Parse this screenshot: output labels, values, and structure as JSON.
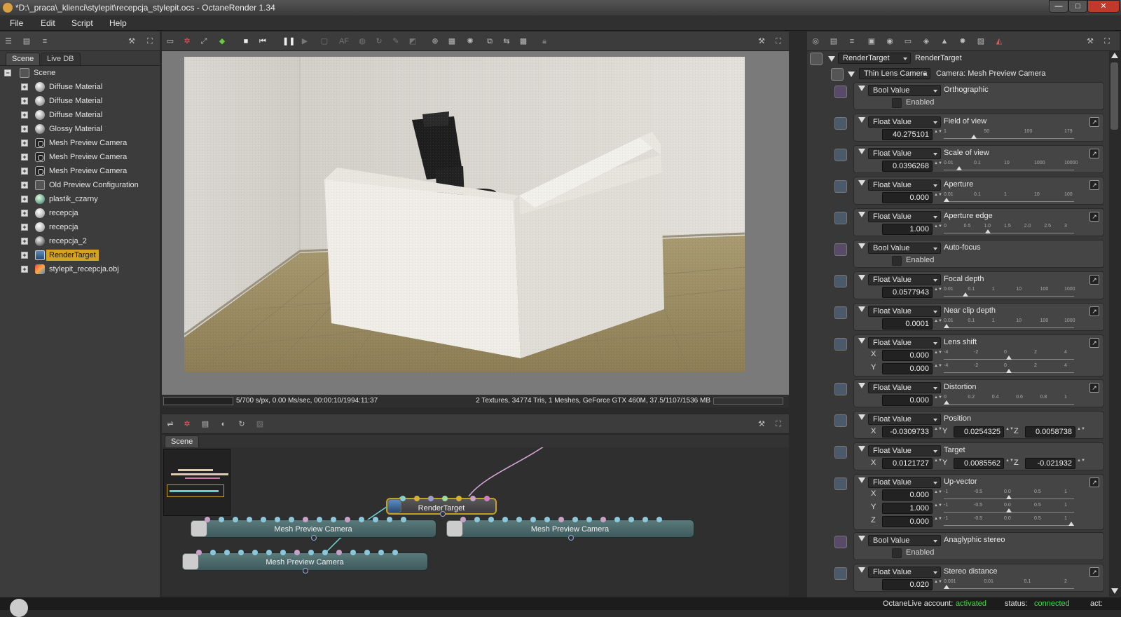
{
  "window": {
    "title": "*D:\\_praca\\_klienci\\stylepit\\recepcja_stylepit.ocs - OctaneRender 1.34",
    "min_label": "—",
    "max_label": "□",
    "close_label": "✕"
  },
  "menu": [
    "File",
    "Edit",
    "Script",
    "Help"
  ],
  "scene_panel": {
    "tabs": [
      "Scene",
      "Live DB"
    ],
    "root": "Scene",
    "items": [
      {
        "label": "Diffuse Material",
        "icon": "diffuse-material-icon"
      },
      {
        "label": "Diffuse Material",
        "icon": "diffuse-material-icon"
      },
      {
        "label": "Diffuse Material",
        "icon": "diffuse-material-icon"
      },
      {
        "label": "Glossy Material",
        "icon": "glossy-material-icon"
      },
      {
        "label": "Mesh Preview Camera",
        "icon": "camera-icon"
      },
      {
        "label": "Mesh Preview Camera",
        "icon": "camera-icon"
      },
      {
        "label": "Mesh Preview Camera",
        "icon": "camera-icon"
      },
      {
        "label": "Old Preview Configuration",
        "icon": "config-icon"
      },
      {
        "label": "plastik_czarny",
        "icon": "material-icon"
      },
      {
        "label": "recepcja",
        "icon": "material-icon"
      },
      {
        "label": "recepcja",
        "icon": "material-icon"
      },
      {
        "label": "recepcja_2",
        "icon": "material-icon"
      },
      {
        "label": "RenderTarget",
        "icon": "render-target-icon",
        "selected": true
      },
      {
        "label": "stylepit_recepcja.obj",
        "icon": "mesh-icon"
      }
    ]
  },
  "render": {
    "status_left": "5/700 s/px, 0.00 Ms/sec, 00:00:10/1994:11:37",
    "status_right": "2 Textures, 34774 Tris, 1 Meshes, GeForce GTX 460M, 37.5/1107/1536 MB"
  },
  "graph": {
    "tab": "Scene",
    "nodes": {
      "render_target": "RenderTarget",
      "camera_1": "Mesh Preview Camera",
      "camera_2": "Mesh Preview Camera",
      "camera_3": "Mesh Preview Camera"
    }
  },
  "props": {
    "header_combo": "RenderTarget",
    "header_label": "RenderTarget",
    "camera_combo": "Thin Lens Camera",
    "camera_label": "Camera:  Mesh Preview Camera",
    "enabled_label": "Enabled",
    "rows": {
      "orthographic": {
        "type": "Bool Value",
        "label": "Orthographic"
      },
      "fov": {
        "type": "Float Value",
        "label": "Field of view",
        "value": "40.275101",
        "ticks": [
          "1",
          "50",
          "100",
          "179"
        ]
      },
      "scale": {
        "type": "Float Value",
        "label": "Scale of view",
        "value": "0.0396268",
        "ticks": [
          "0.01",
          "0.1",
          "10",
          "1000",
          "10000"
        ]
      },
      "aperture": {
        "type": "Float Value",
        "label": "Aperture",
        "value": "0.000",
        "ticks": [
          "0.01",
          "0.1",
          "1",
          "10",
          "100"
        ]
      },
      "aperture_edge": {
        "type": "Float Value",
        "label": "Aperture edge",
        "value": "1.000",
        "ticks": [
          "0",
          "0.5",
          "1.0",
          "1.5",
          "2.0",
          "2.5",
          "3"
        ]
      },
      "autofocus": {
        "type": "Bool Value",
        "label": "Auto-focus"
      },
      "focal_depth": {
        "type": "Float Value",
        "label": "Focal depth",
        "value": "0.0577943",
        "ticks": [
          "0.01",
          "0.1",
          "1",
          "10",
          "100",
          "1000"
        ]
      },
      "near_clip": {
        "type": "Float Value",
        "label": "Near clip depth",
        "value": "0.0001",
        "ticks": [
          "0.01",
          "0.1",
          "1",
          "10",
          "100",
          "1000"
        ]
      },
      "lens_shift": {
        "type": "Float Value",
        "label": "Lens shift",
        "x": "0.000",
        "y": "0.000",
        "ticks": [
          "-4",
          "-2",
          "0",
          "2",
          "4"
        ]
      },
      "distortion": {
        "type": "Float Value",
        "label": "Distortion",
        "value": "0.000",
        "ticks": [
          "0",
          "0.2",
          "0.4",
          "0.6",
          "0.8",
          "1"
        ]
      },
      "position": {
        "type": "Float Value",
        "label": "Position",
        "x": "-0.0309733",
        "y": "0.0254325",
        "z": "0.0058738"
      },
      "target": {
        "type": "Float Value",
        "label": "Target",
        "x": "0.0121727",
        "y": "0.0085562",
        "z": "-0.021932"
      },
      "upvector": {
        "type": "Float Value",
        "label": "Up-vector",
        "x": "0.000",
        "y": "1.000",
        "z": "0.000",
        "ticks": [
          "-1",
          "-0.5",
          "0.0",
          "0.5",
          "1"
        ]
      },
      "anaglyphic": {
        "type": "Bool Value",
        "label": "Anaglyphic stereo"
      },
      "stereo_dist": {
        "type": "Float Value",
        "label": "Stereo distance",
        "value": "0.020",
        "ticks": [
          "0.001",
          "0.01",
          "0.1",
          "2"
        ]
      }
    },
    "axis": {
      "x": "X",
      "y": "Y",
      "z": "Z"
    }
  },
  "statusbar": {
    "account_label": "OctaneLive account:",
    "account_value": "activated",
    "status_label": "status:",
    "status_value": "connected",
    "act_label": "act:"
  },
  "colors": {
    "accent_selected": "#d4a420",
    "status_green": "#44dd44",
    "node_teal": "#4a6a6c"
  }
}
